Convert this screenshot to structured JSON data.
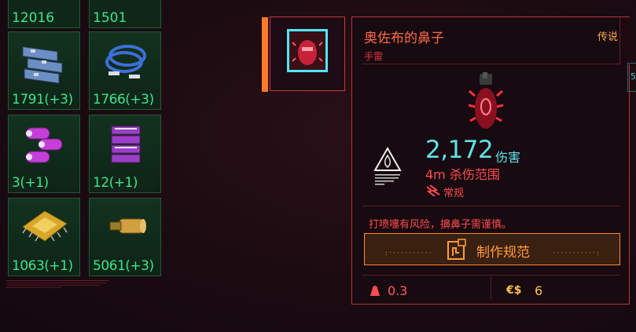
{
  "inventory": {
    "top_counts": [
      "12016",
      "1501"
    ],
    "cells": [
      {
        "name": "cell-circuit-boards",
        "qty": "1791(+3)"
      },
      {
        "name": "cell-blue-cables",
        "qty": "1766(+3)"
      },
      {
        "name": "cell-purple-capsules",
        "qty": "3(+1)"
      },
      {
        "name": "cell-purple-coils",
        "qty": "12(+1)"
      },
      {
        "name": "cell-gold-chip",
        "qty": "1063(+1)"
      },
      {
        "name": "cell-brass-part",
        "qty": "5061(+3)"
      }
    ]
  },
  "item": {
    "name": "奥佐布的鼻子",
    "rarity": "传说",
    "type": "手雷",
    "damage": "2,172",
    "damage_label": "伤害",
    "radius": "4m 杀伤范围",
    "damage_kind": "常规",
    "flavor": "打喷嚏有风险，擤鼻子需谨慎。",
    "craft_label": "制作规范",
    "weight": "0.3",
    "currency_symbol": "€$",
    "price": "6"
  },
  "side_tab": {
    "label": "5"
  },
  "colors": {
    "accent_red": "#c7383d",
    "slot_orange": "#ff7a2a",
    "cyan": "#5fe4ea",
    "quantity_green": "#3fe48b",
    "rarity_gold": "#ffab4a"
  }
}
